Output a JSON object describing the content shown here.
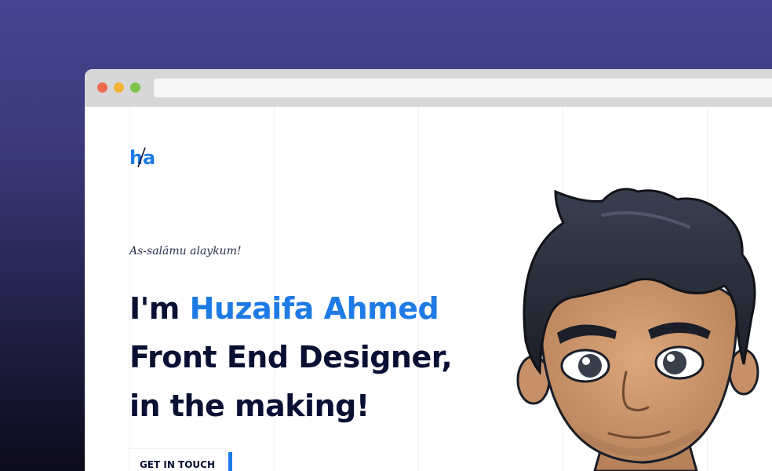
{
  "browser": {
    "dots": [
      {
        "name": "close",
        "color": "#ee6a4d"
      },
      {
        "name": "minimize",
        "color": "#f2b233"
      },
      {
        "name": "maximize",
        "color": "#7cc44a"
      }
    ]
  },
  "hero": {
    "logo": {
      "letter_left": "h",
      "letter_right": "a",
      "color": "#1e7be6"
    },
    "greeting": "As-salāmu alaykum!",
    "headline": {
      "prefix": "I'm ",
      "name": "Huzaifa Ahmed",
      "line2": "Front End Designer,",
      "line3": "in the making!"
    },
    "cta_label": "GET IN TOUCH"
  },
  "colors": {
    "accent": "#1e7be6",
    "heading": "#0a1033"
  }
}
